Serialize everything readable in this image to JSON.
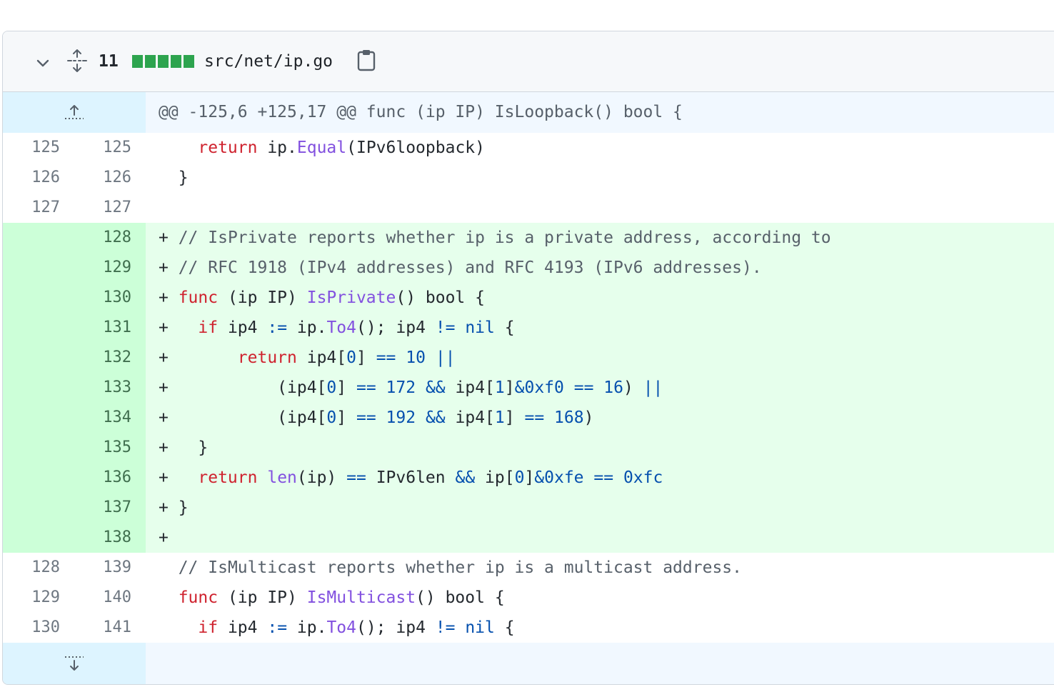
{
  "file": {
    "changes_count": "11",
    "path": "src/net/ip.go",
    "stat_colors": [
      "#2da44e",
      "#2da44e",
      "#2da44e",
      "#2da44e",
      "#2da44e"
    ]
  },
  "icons": {
    "collapse": "chevron-down-icon",
    "expand_all": "unfold-icon",
    "copy": "copy-icon",
    "expand_up": "fold-up-icon",
    "expand_down": "fold-down-icon"
  },
  "hunk_header": "@@ -125,6 +125,17 @@ func (ip IP) IsLoopback() bool {",
  "lines": [
    {
      "type": "ctx",
      "old": "125",
      "new": "125",
      "tokens": [
        [
          "",
          "\t"
        ],
        [
          "k",
          "return"
        ],
        [
          "",
          " ip."
        ],
        [
          "f",
          "Equal"
        ],
        [
          "",
          "(IPv6loopback)"
        ]
      ]
    },
    {
      "type": "ctx",
      "old": "126",
      "new": "126",
      "tokens": [
        [
          "",
          "}"
        ]
      ]
    },
    {
      "type": "ctx",
      "old": "127",
      "new": "127",
      "tokens": []
    },
    {
      "type": "add",
      "old": "",
      "new": "128",
      "tokens": [
        [
          "",
          "+ "
        ],
        [
          "c",
          "// IsPrivate reports whether ip is a private address, according to"
        ]
      ]
    },
    {
      "type": "add",
      "old": "",
      "new": "129",
      "tokens": [
        [
          "",
          "+ "
        ],
        [
          "c",
          "// RFC 1918 (IPv4 addresses) and RFC 4193 (IPv6 addresses)."
        ]
      ]
    },
    {
      "type": "add",
      "old": "",
      "new": "130",
      "tokens": [
        [
          "",
          "+ "
        ],
        [
          "k",
          "func"
        ],
        [
          "",
          " (ip IP) "
        ],
        [
          "f",
          "IsPrivate"
        ],
        [
          "",
          "() bool {"
        ]
      ]
    },
    {
      "type": "add",
      "old": "",
      "new": "131",
      "tokens": [
        [
          "",
          "+ \t"
        ],
        [
          "k",
          "if"
        ],
        [
          "",
          " ip4 "
        ],
        [
          "n",
          ":="
        ],
        [
          "",
          " ip."
        ],
        [
          "f",
          "To4"
        ],
        [
          "",
          "(); ip4 "
        ],
        [
          "n",
          "!="
        ],
        [
          "",
          " "
        ],
        [
          "n",
          "nil"
        ],
        [
          "",
          " {"
        ]
      ]
    },
    {
      "type": "add",
      "old": "",
      "new": "132",
      "tokens": [
        [
          "",
          "+ \t\t"
        ],
        [
          "k",
          "return"
        ],
        [
          "",
          " ip4["
        ],
        [
          "n",
          "0"
        ],
        [
          "",
          "] "
        ],
        [
          "n",
          "=="
        ],
        [
          "",
          " "
        ],
        [
          "n",
          "10"
        ],
        [
          "",
          " "
        ],
        [
          "n",
          "||"
        ]
      ]
    },
    {
      "type": "add",
      "old": "",
      "new": "133",
      "tokens": [
        [
          "",
          "+ \t\t\t(ip4["
        ],
        [
          "n",
          "0"
        ],
        [
          "",
          "] "
        ],
        [
          "n",
          "=="
        ],
        [
          "",
          " "
        ],
        [
          "n",
          "172"
        ],
        [
          "",
          " "
        ],
        [
          "n",
          "&&"
        ],
        [
          "",
          " ip4["
        ],
        [
          "n",
          "1"
        ],
        [
          "",
          "]"
        ],
        [
          "n",
          "&0xf0"
        ],
        [
          "",
          " "
        ],
        [
          "n",
          "=="
        ],
        [
          "",
          " "
        ],
        [
          "n",
          "16"
        ],
        [
          "",
          ") "
        ],
        [
          "n",
          "||"
        ]
      ]
    },
    {
      "type": "add",
      "old": "",
      "new": "134",
      "tokens": [
        [
          "",
          "+ \t\t\t(ip4["
        ],
        [
          "n",
          "0"
        ],
        [
          "",
          "] "
        ],
        [
          "n",
          "=="
        ],
        [
          "",
          " "
        ],
        [
          "n",
          "192"
        ],
        [
          "",
          " "
        ],
        [
          "n",
          "&&"
        ],
        [
          "",
          " ip4["
        ],
        [
          "n",
          "1"
        ],
        [
          "",
          "] "
        ],
        [
          "n",
          "=="
        ],
        [
          "",
          " "
        ],
        [
          "n",
          "168"
        ],
        [
          "",
          ")"
        ]
      ]
    },
    {
      "type": "add",
      "old": "",
      "new": "135",
      "tokens": [
        [
          "",
          "+ \t}"
        ]
      ]
    },
    {
      "type": "add",
      "old": "",
      "new": "136",
      "tokens": [
        [
          "",
          "+ \t"
        ],
        [
          "k",
          "return"
        ],
        [
          "",
          " "
        ],
        [
          "f",
          "len"
        ],
        [
          "",
          "(ip) "
        ],
        [
          "n",
          "=="
        ],
        [
          "",
          " IPv6len "
        ],
        [
          "n",
          "&&"
        ],
        [
          "",
          " ip["
        ],
        [
          "n",
          "0"
        ],
        [
          "",
          "]"
        ],
        [
          "n",
          "&0xfe"
        ],
        [
          "",
          " "
        ],
        [
          "n",
          "=="
        ],
        [
          "",
          " "
        ],
        [
          "n",
          "0xfc"
        ]
      ]
    },
    {
      "type": "add",
      "old": "",
      "new": "137",
      "tokens": [
        [
          "",
          "+ }"
        ]
      ]
    },
    {
      "type": "add",
      "old": "",
      "new": "138",
      "tokens": [
        [
          "",
          "+"
        ]
      ]
    },
    {
      "type": "ctx",
      "old": "128",
      "new": "139",
      "tokens": [
        [
          "c",
          "// IsMulticast reports whether ip is a multicast address."
        ]
      ]
    },
    {
      "type": "ctx",
      "old": "129",
      "new": "140",
      "tokens": [
        [
          "k",
          "func"
        ],
        [
          "",
          " (ip IP) "
        ],
        [
          "f",
          "IsMulticast"
        ],
        [
          "",
          "() bool {"
        ]
      ]
    },
    {
      "type": "ctx",
      "old": "130",
      "new": "141",
      "tokens": [
        [
          "",
          "\t"
        ],
        [
          "k",
          "if"
        ],
        [
          "",
          " ip4 "
        ],
        [
          "n",
          ":="
        ],
        [
          "",
          " ip."
        ],
        [
          "f",
          "To4"
        ],
        [
          "",
          "(); ip4 "
        ],
        [
          "n",
          "!="
        ],
        [
          "",
          " "
        ],
        [
          "n",
          "nil"
        ],
        [
          "",
          " {"
        ]
      ]
    }
  ]
}
